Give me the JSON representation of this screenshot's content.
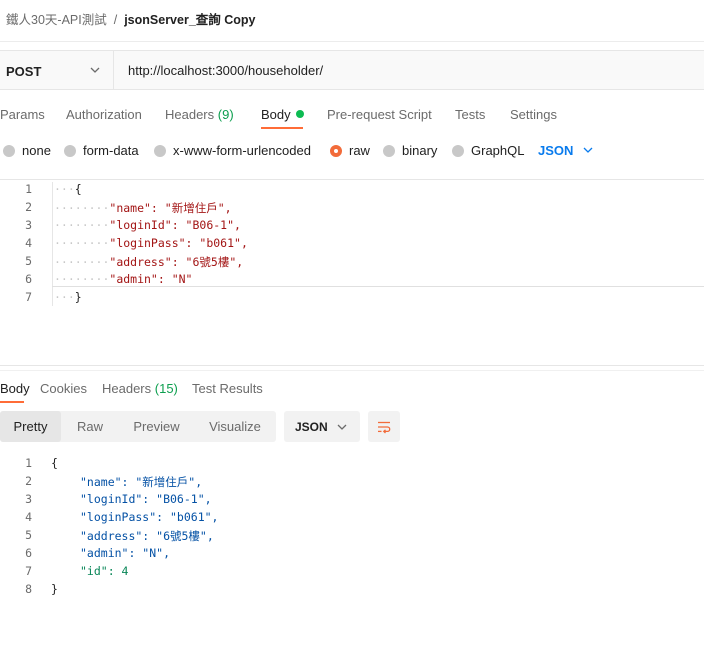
{
  "breadcrumb": {
    "collection": "鐵人30天-API測試",
    "separator": "/",
    "request": "jsonServer_查詢 Copy"
  },
  "request": {
    "method": "POST",
    "url": "http://localhost:3000/householder/"
  },
  "tabs": [
    {
      "label": "Params"
    },
    {
      "label": "Authorization"
    },
    {
      "label": "Headers",
      "count": "(9)"
    },
    {
      "label": "Body"
    },
    {
      "label": "Pre-request Script"
    },
    {
      "label": "Tests"
    },
    {
      "label": "Settings"
    }
  ],
  "body_modes": [
    {
      "label": "none"
    },
    {
      "label": "form-data"
    },
    {
      "label": "x-www-form-urlencoded"
    },
    {
      "label": "raw"
    },
    {
      "label": "binary"
    },
    {
      "label": "GraphQL"
    }
  ],
  "body_format": "JSON",
  "request_body": {
    "line_numbers": [
      "1",
      "2",
      "3",
      "4",
      "5",
      "6",
      "7"
    ],
    "lines": [
      "{",
      "\"name\": \"新增住戶\",",
      "\"loginId\": \"B06-1\",",
      "\"loginPass\": \"b061\",",
      "\"address\": \"6號5樓\",",
      "\"admin\": \"N\"",
      "}"
    ]
  },
  "response_tabs": [
    {
      "label": "Body"
    },
    {
      "label": "Cookies"
    },
    {
      "label": "Headers",
      "count": "(15)"
    },
    {
      "label": "Test Results"
    }
  ],
  "view_modes": [
    "Pretty",
    "Raw",
    "Preview",
    "Visualize"
  ],
  "response_format": "JSON",
  "response_body": {
    "line_numbers": [
      "1",
      "2",
      "3",
      "4",
      "5",
      "6",
      "7",
      "8"
    ],
    "lines": [
      "{",
      "\"name\": \"新增住戶\",",
      "\"loginId\": \"B06-1\",",
      "\"loginPass\": \"b061\",",
      "\"address\": \"6號5樓\",",
      "\"admin\": \"N\",",
      "\"id\": 4",
      "}"
    ]
  },
  "colors": {
    "accent": "#ff6c37",
    "json_blue": "#097bed",
    "count_green": "#0d9f4f",
    "key": "#a31515",
    "string": "#0451a5",
    "number": "#098658"
  },
  "icons": {
    "method_dropdown": "chevron-down-icon",
    "format_dropdown": "chevron-down-icon",
    "wrap": "text-wrap-icon",
    "body_indicator": "dot-icon"
  }
}
